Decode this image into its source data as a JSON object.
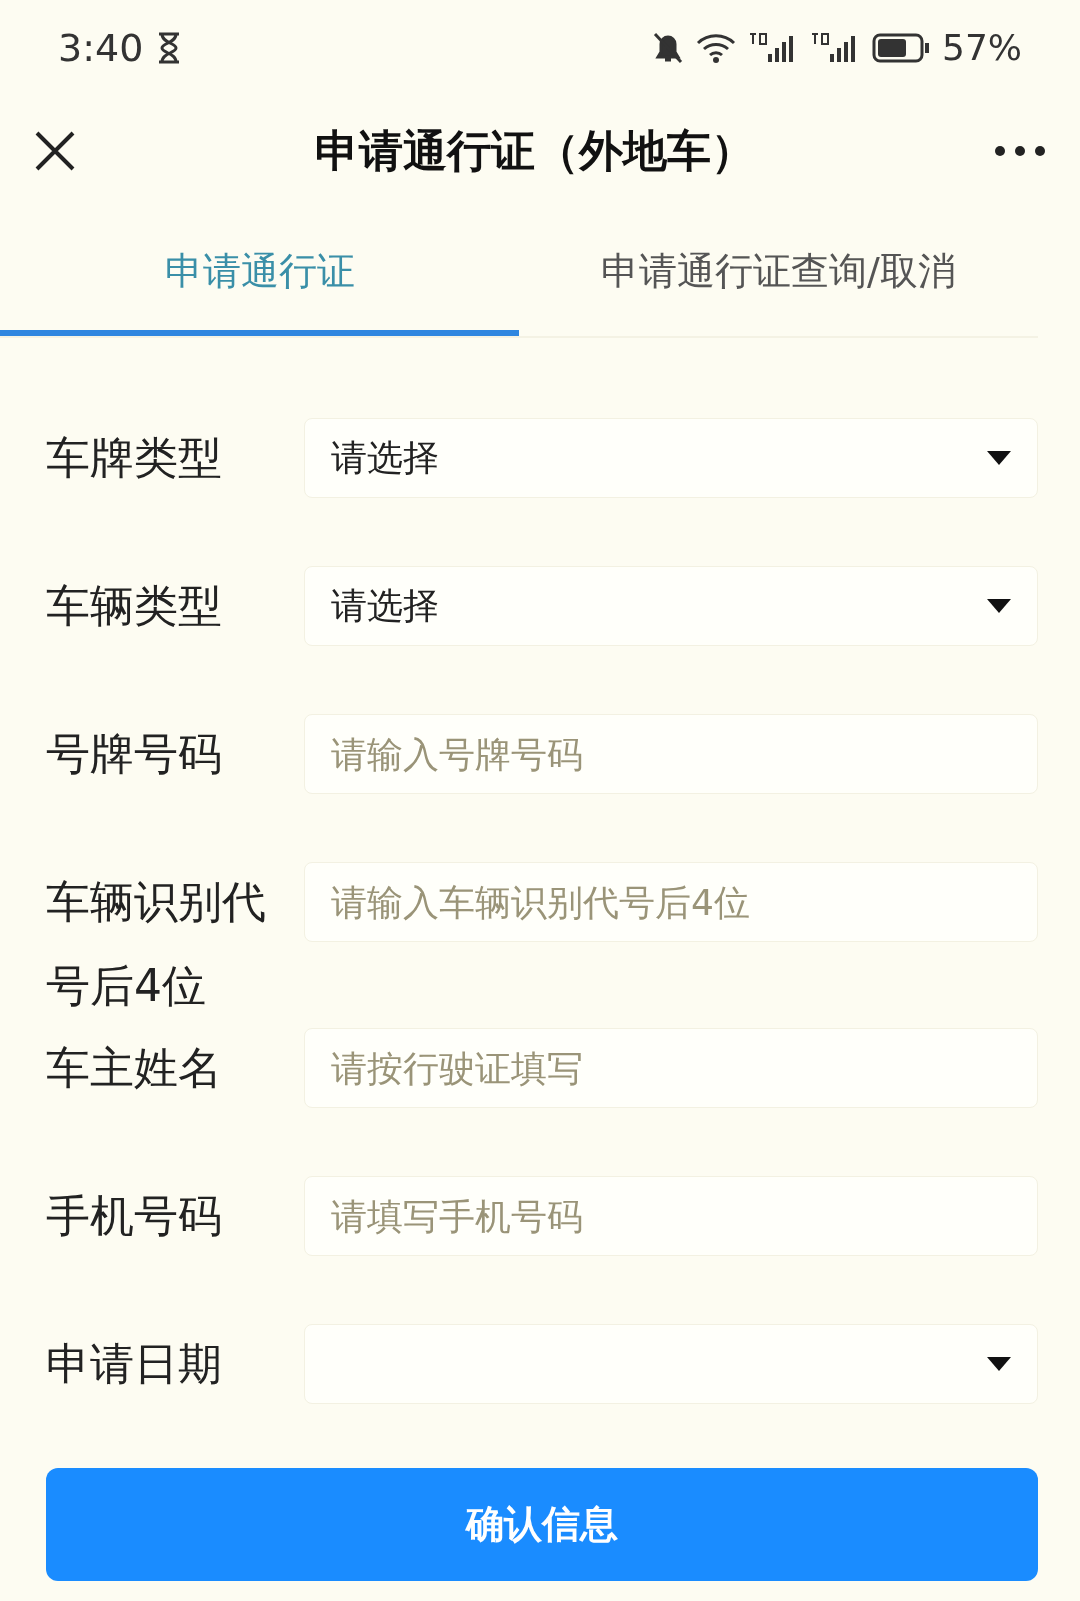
{
  "status_bar": {
    "time": "3:40",
    "battery": "57%"
  },
  "header": {
    "title": "申请通行证（外地车）"
  },
  "tabs": [
    {
      "label": "申请通行证",
      "selected": true
    },
    {
      "label": "申请通行证查询/取消",
      "selected": false
    }
  ],
  "form": {
    "fields": [
      {
        "label": "车牌类型",
        "kind": "select",
        "value": "请选择"
      },
      {
        "label": "车辆类型",
        "kind": "select",
        "value": "请选择"
      },
      {
        "label": "号牌号码",
        "kind": "input",
        "placeholder": "请输入号牌号码"
      },
      {
        "label": "车辆识别代号后4位",
        "kind": "input",
        "placeholder": "请输入车辆识别代号后4位"
      },
      {
        "label": "车主姓名",
        "kind": "input",
        "placeholder": "请按行驶证填写"
      },
      {
        "label": "手机号码",
        "kind": "input",
        "placeholder": "请填写手机号码"
      },
      {
        "label": "申请日期",
        "kind": "select"
      }
    ]
  },
  "submit": {
    "label": "确认信息"
  }
}
